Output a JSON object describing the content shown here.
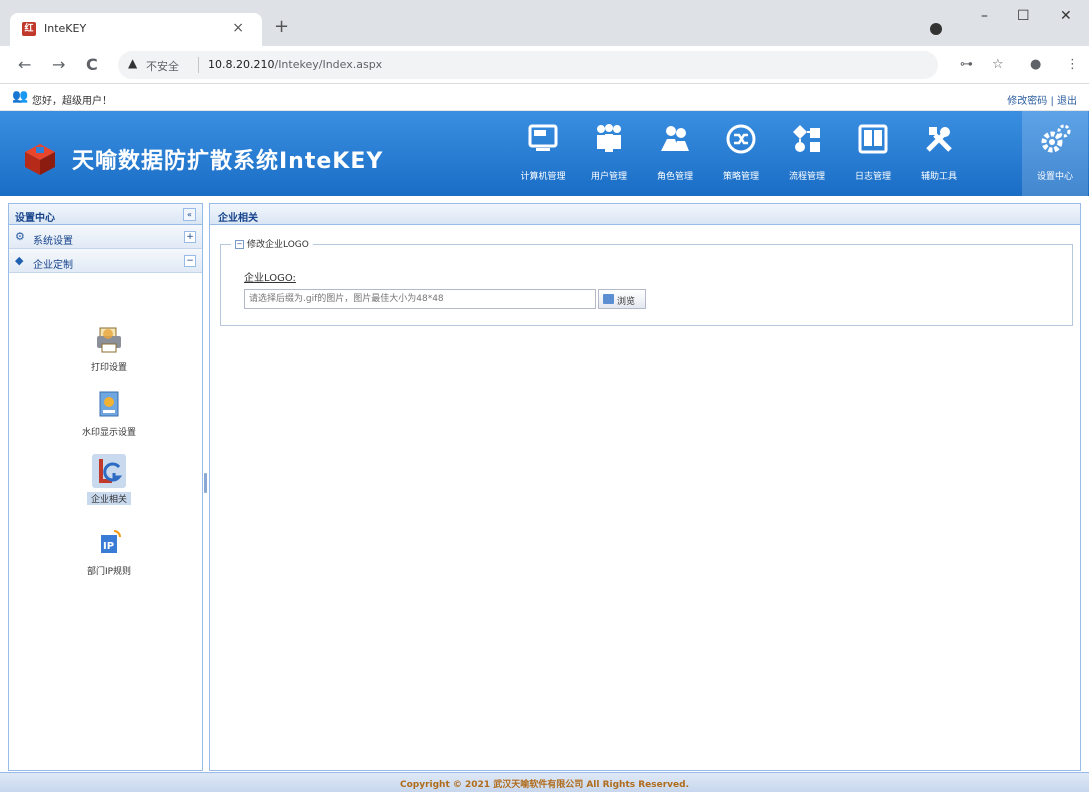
{
  "browser": {
    "tab_title": "InteKEY",
    "tab_favicon": "红",
    "close_glyph": "×",
    "new_tab_glyph": "+",
    "minimize_glyph": "–",
    "maximize_glyph": "☐",
    "window_close_glyph": "✕",
    "back_glyph": "←",
    "forward_glyph": "→",
    "reload_glyph": "C",
    "warning_glyph": "▲",
    "insecure_label": "不安全",
    "url_host": "10.8.20.210",
    "url_path": "/Intekey/Index.aspx",
    "key_glyph": "⊶",
    "star_glyph": "☆",
    "profile_glyph": "●",
    "menu_glyph": "⋮"
  },
  "greeting": {
    "icon": "users-icon",
    "text": "您好，超级用户！",
    "links": [
      "修改密码",
      "退出"
    ],
    "separator": " | "
  },
  "banner": {
    "title": "天喻数据防扩散系统InteKEY",
    "nav": [
      {
        "label": "计算机管理",
        "icon": "computer-icon"
      },
      {
        "label": "用户管理",
        "icon": "users-icon"
      },
      {
        "label": "角色管理",
        "icon": "roles-icon"
      },
      {
        "label": "策略管理",
        "icon": "shuffle-icon"
      },
      {
        "label": "流程管理",
        "icon": "flow-icon"
      },
      {
        "label": "日志管理",
        "icon": "book-icon"
      },
      {
        "label": "辅助工具",
        "icon": "tools-icon"
      },
      {
        "label": "设置中心",
        "icon": "gear-icon",
        "active": true
      }
    ]
  },
  "left_panel": {
    "title": "设置中心",
    "collapse_glyph": "«",
    "sections": [
      {
        "title": "系统设置",
        "toggle": "+",
        "icon": "gear-icon"
      },
      {
        "title": "企业定制",
        "toggle": "−",
        "icon": "enterprise-icon"
      }
    ],
    "features": [
      {
        "label": "打印设置",
        "icon": "printer-icon"
      },
      {
        "label": "水印显示设置",
        "icon": "watermark-icon"
      },
      {
        "label": "企业相关",
        "icon": "lg-logo-icon",
        "selected": true
      },
      {
        "label": "部门IP规则",
        "icon": "ip-icon"
      }
    ]
  },
  "right_panel": {
    "title": "企业相关",
    "fieldset_legend": "修改企业LOGO",
    "legend_toggle": "−",
    "field_label": "企业LOGO:",
    "file_placeholder": "请选择后缀为.gif的图片，图片最佳大小为48*48",
    "browse_label": "浏览"
  },
  "footer": {
    "copyright": "Copyright © 2021 武汉天喻软件有限公司 All Rights Reserved."
  },
  "colors": {
    "banner_top": "#3a8fe1",
    "banner_bottom": "#1a6dc5",
    "panel_border": "#99bbe8",
    "panel_title": "#15428b",
    "footer_text": "#b06b1a"
  }
}
